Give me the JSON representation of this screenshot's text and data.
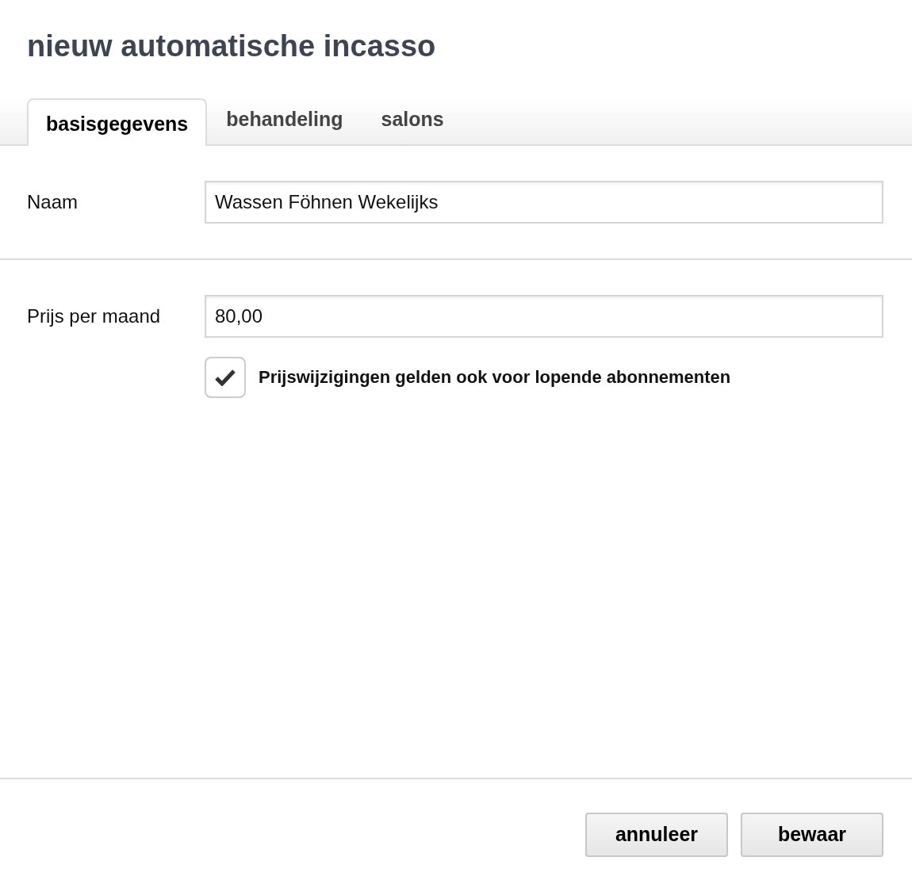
{
  "title": "nieuw automatische incasso",
  "tabs": [
    {
      "label": "basisgegevens",
      "selected": true
    },
    {
      "label": "behandeling",
      "selected": false
    },
    {
      "label": "salons",
      "selected": false
    }
  ],
  "sections": [
    {
      "fields": [
        {
          "label": "Naam",
          "value": "Wassen Föhnen Wekelijks"
        }
      ]
    },
    {
      "fields": [
        {
          "label": "Prijs per maand",
          "value": "80,00"
        }
      ],
      "checkbox": {
        "label": "Prijswijzigingen gelden ook voor lopende abonnementen",
        "checked": true
      }
    }
  ],
  "buttons": [
    "annuleer",
    "bewaar"
  ]
}
